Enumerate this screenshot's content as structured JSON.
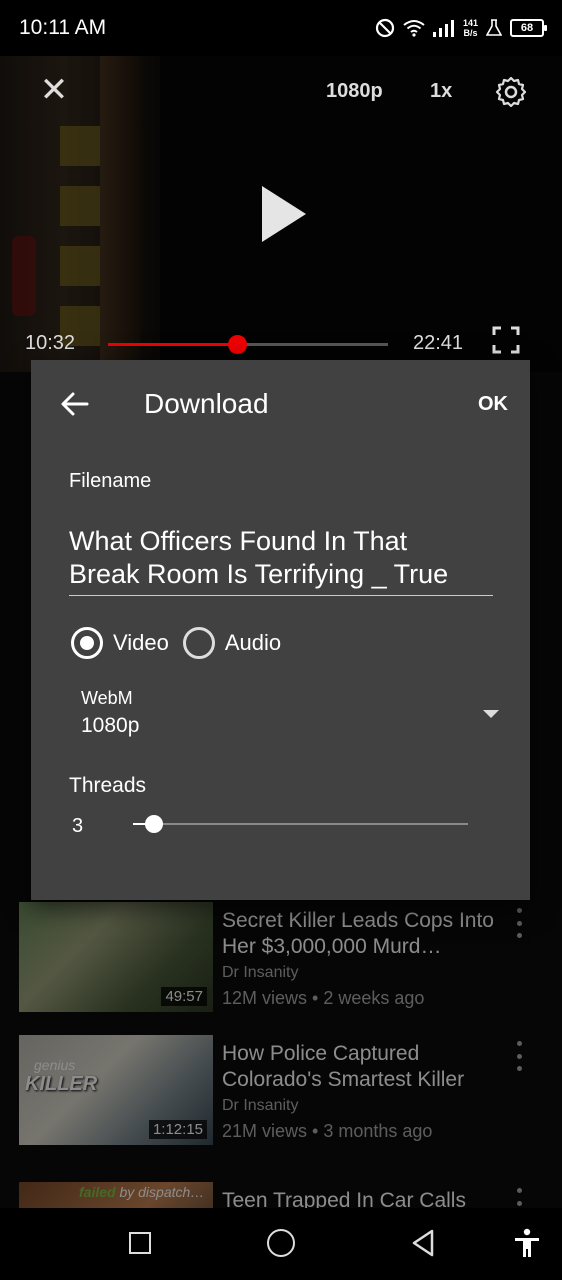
{
  "status_bar": {
    "time": "10:11 AM",
    "speed_top": "141",
    "speed_bottom": "B/s",
    "battery": "68",
    "icons": [
      "dnd-icon",
      "wifi-icon",
      "signal-icon",
      "flask-icon",
      "battery-icon"
    ]
  },
  "player": {
    "quality": "1080p",
    "speed": "1x",
    "current_time": "10:32",
    "duration": "22:41",
    "progress": 0.465,
    "progress_color": "#e00000"
  },
  "dialog": {
    "title": "Download",
    "ok_label": "OK",
    "filename_label": "Filename",
    "filename_value": "What Officers Found In That\nBreak Room Is Terrifying _ True",
    "radio_video": "Video",
    "radio_audio": "Audio",
    "selected": "Video",
    "format_type": "WebM",
    "format_resolution": "1080p",
    "threads_label": "Threads",
    "threads_value": "3",
    "threads_fraction": 0.06
  },
  "videos": [
    {
      "title": "Secret Killer Leads Cops Into Her $3,000,000 Murd…",
      "channel": "Dr Insanity",
      "meta": "12M views • 2 weeks ago",
      "duration": "49:57"
    },
    {
      "title": "How Police Captured Colorado's Smartest Killer",
      "channel": "Dr Insanity",
      "meta": "21M views • 3 months ago",
      "duration": "1:12:15",
      "thumb_text_top": "genius",
      "thumb_text_main": "KILLER"
    },
    {
      "title": "Teen Trapped In Car Calls",
      "thumb_text_corner_a": "failed",
      "thumb_text_corner_b": " by dispatch…"
    }
  ]
}
